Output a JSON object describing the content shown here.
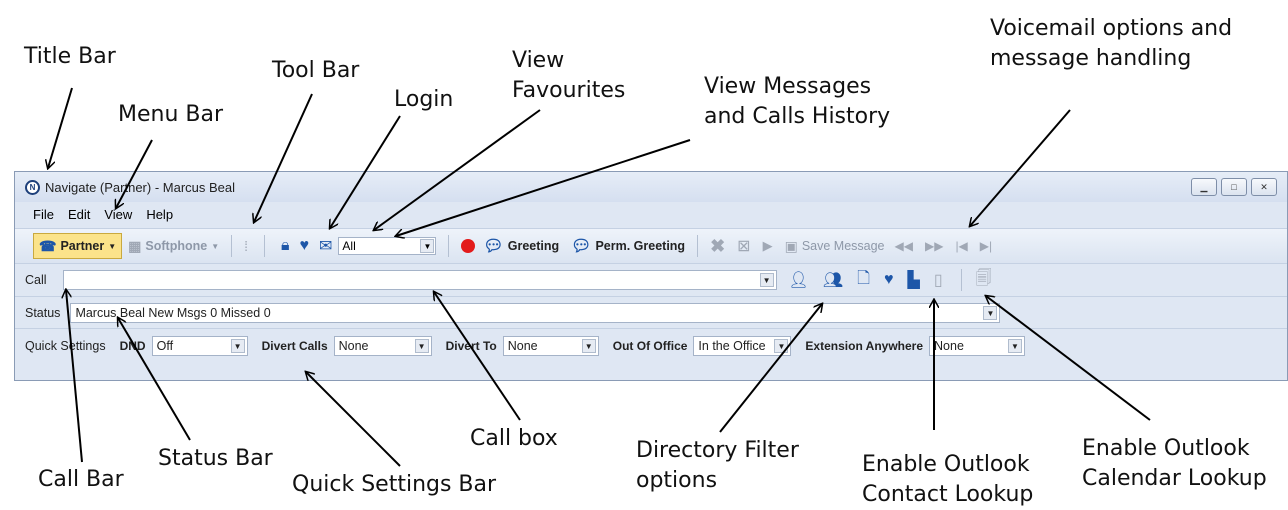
{
  "callouts": {
    "title_bar": "Title Bar",
    "menu_bar": "Menu Bar",
    "tool_bar": "Tool Bar",
    "login": "Login",
    "view_favourites_1": "View",
    "view_favourites_2": "Favourites",
    "view_messages_1": "View Messages",
    "view_messages_2": "and Calls History",
    "voicemail_1": "Voicemail options and",
    "voicemail_2": "message handling",
    "call_bar": "Call Bar",
    "status_bar": "Status Bar",
    "quick_settings_bar": "Quick Settings Bar",
    "call_box": "Call box",
    "directory_filter_1": "Directory Filter",
    "directory_filter_2": "options",
    "outlook_contact_1": "Enable Outlook",
    "outlook_contact_2": "Contact Lookup",
    "outlook_calendar_1": "Enable Outlook",
    "outlook_calendar_2": "Calendar Lookup"
  },
  "window": {
    "title": "Navigate (Partner) - Marcus Beal",
    "app_icon": "navigate-logo-icon"
  },
  "menu": [
    "File",
    "Edit",
    "View",
    "Help"
  ],
  "toolbar": {
    "mode_label": "Partner",
    "softphone_label": "Softphone",
    "filter_value": "All",
    "greeting_label": "Greeting",
    "perm_greeting_label": "Perm. Greeting",
    "save_message_label": "Save Message"
  },
  "call_bar": {
    "label": "Call",
    "value": ""
  },
  "status_bar": {
    "label": "Status",
    "text": "Marcus Beal  New Msgs  0 Missed 0"
  },
  "quick_settings": {
    "label": "Quick Settings",
    "dnd_label": "DND",
    "dnd_value": "Off",
    "divert_calls_label": "Divert Calls",
    "divert_calls_value": "None",
    "divert_to_label": "Divert To",
    "divert_to_value": "None",
    "out_of_office_label": "Out Of Office",
    "out_of_office_value": "In the Office",
    "extension_anywhere_label": "Extension Anywhere",
    "extension_anywhere_value": "None"
  },
  "colors": {
    "record": "#e31b1b",
    "icon_blue": "#1d56a8",
    "mode_highlight": "#fbe38a",
    "window_bg": "#dfe7f3"
  }
}
